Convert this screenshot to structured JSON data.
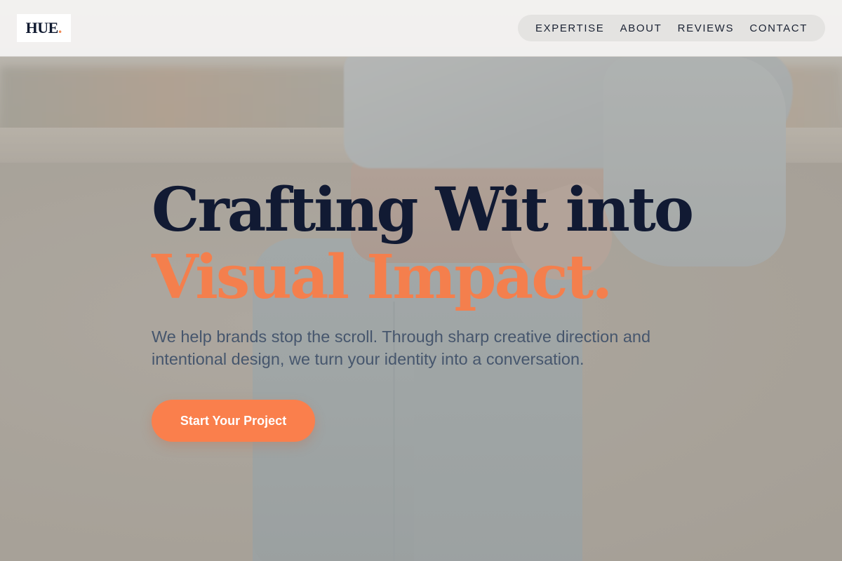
{
  "brand": {
    "logo_text": "HUE",
    "logo_dot": ".",
    "accent_color": "#f47f4d",
    "dark_color": "#111a33"
  },
  "nav": {
    "items": [
      {
        "label": "EXPERTISE"
      },
      {
        "label": "ABOUT"
      },
      {
        "label": "REVIEWS"
      },
      {
        "label": "CONTACT"
      }
    ]
  },
  "hero": {
    "headline_line1": "Crafting Wit into",
    "headline_line2": "Visual Impact.",
    "description": "We help brands stop the scroll. Through sharp creative direction and intentional design, we turn your identity into a conversation.",
    "cta_label": "Start Your Project"
  }
}
